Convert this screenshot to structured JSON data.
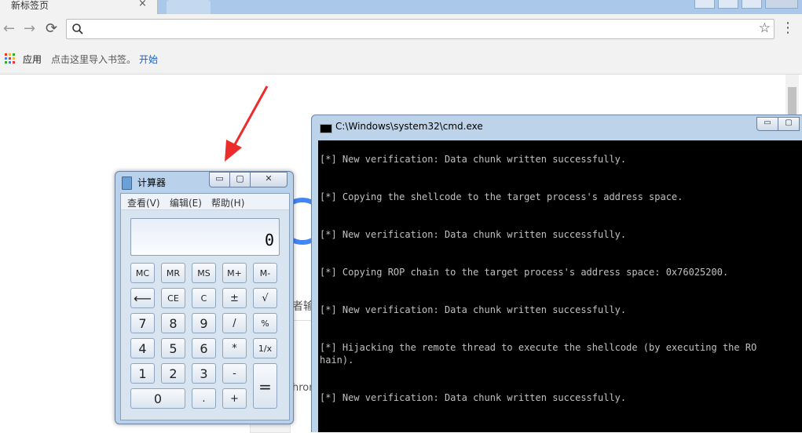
{
  "browser": {
    "tab_title": "新标签页",
    "tab_close": "×",
    "back": "←",
    "forward": "→",
    "reload": "⟳",
    "star": "☆",
    "menu": "⋮",
    "bookmarks": {
      "apps": "应用",
      "import_hint": "点击这里导入书签。",
      "start": "开始"
    },
    "background_fragments": [
      "者输",
      "hron"
    ]
  },
  "calculator": {
    "title": "计算器",
    "menu": [
      "查看(V)",
      "编辑(E)",
      "帮助(H)"
    ],
    "display": "0",
    "buttons": {
      "mc": "MC",
      "mr": "MR",
      "ms": "MS",
      "mplus": "M+",
      "mminus": "M-",
      "back": "⟵",
      "ce": "CE",
      "c": "C",
      "plusminus": "±",
      "sqrt": "√",
      "n7": "7",
      "n8": "8",
      "n9": "9",
      "div": "/",
      "pct": "%",
      "n4": "4",
      "n5": "5",
      "n6": "6",
      "mul": "*",
      "recip": "1/x",
      "n1": "1",
      "n2": "2",
      "n3": "3",
      "sub": "-",
      "eq": "=",
      "n0": "0",
      "dot": ".",
      "add": "+"
    },
    "min": "▭",
    "max": "▢",
    "close": "✕"
  },
  "cmd": {
    "title": "C:\\Windows\\system32\\cmd.exe",
    "lines": [
      "",
      "[*] New verification: Data chunk written successfully.",
      "",
      "",
      "[*] Copying the shellcode to the target process's address space.",
      "",
      "",
      "[*] New verification: Data chunk written successfully.",
      "",
      "",
      "[*] Copying ROP chain to the target process's address space: 0x76025200.",
      "",
      "",
      "[*] New verification: Data chunk written successfully.",
      "",
      "",
      "[*] Hijacking the remote thread to execute the shellcode (by executing the RO",
      "hain).",
      "",
      "",
      "[*] New verification: Data chunk written successfully."
    ],
    "min": "▭",
    "max": "▢"
  }
}
